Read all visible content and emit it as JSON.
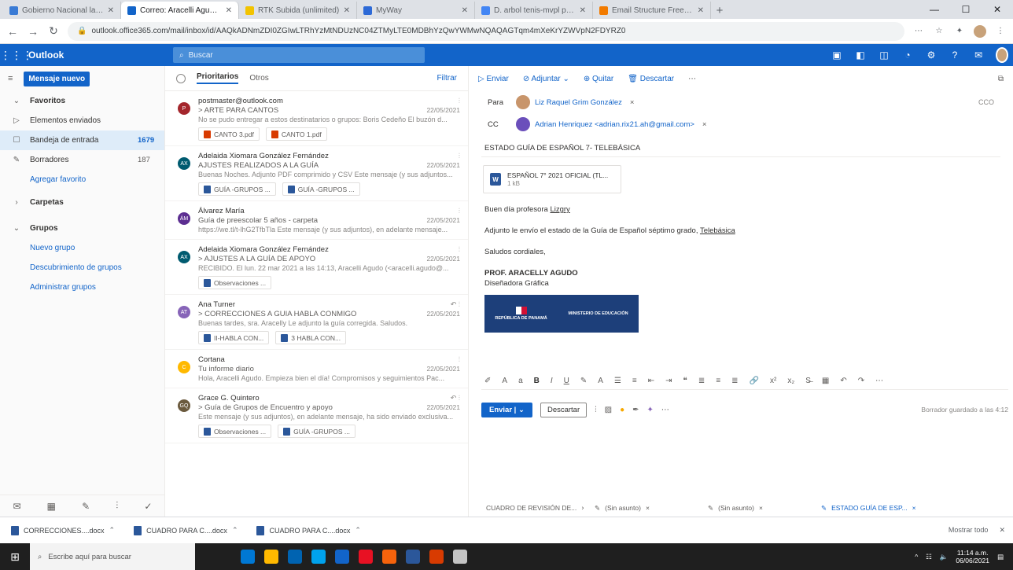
{
  "browser": {
    "tabs": [
      {
        "title": "Gobierno Nacional lanza Plan E...",
        "color": "#3a7bd5"
      },
      {
        "title": "Correo: Aracelli Agudo - Outlook",
        "color": "#1264c9",
        "active": true
      },
      {
        "title": "RTK Subida (unlimited)",
        "color": "#f2c300"
      },
      {
        "title": "MyWay",
        "color": "#2d6ad7"
      },
      {
        "title": "D. arbol tenis-mvpl pell - Buscar",
        "color": "#4285f4"
      },
      {
        "title": "Email Structure Free Vector Art",
        "color": "#f27b00"
      }
    ],
    "new_tab": "+",
    "url": "outlook.office365.com/mail/inbox/id/AAQkADNmZDI0ZGIwLTRhYzMtNDUzNC04ZTMyLTE0MDBhYzQwYWMwNQAQAGTqm4mXeKrYZWVpN2FDYRZ0",
    "window_controls": [
      "—",
      "☐",
      "✕"
    ]
  },
  "outlook": {
    "brand": "Outlook",
    "search_placeholder": "Buscar"
  },
  "leftnav": {
    "new_message": "Mensaje nuevo",
    "favorites": "Favoritos",
    "items": [
      {
        "label": "Elementos enviados",
        "count": "",
        "icon": "▷"
      },
      {
        "label": "Bandeja de entrada",
        "count": "1679",
        "icon": "☐",
        "selected": true
      },
      {
        "label": "Borradores",
        "count": "187",
        "icon": "✎"
      },
      {
        "label": "Agregar favorito",
        "count": "",
        "icon": ""
      }
    ],
    "folders": "Carpetas",
    "groups": "Grupos",
    "group_links": [
      "Nuevo grupo",
      "Descubrimiento de grupos",
      "Administrar grupos"
    ]
  },
  "msglist": {
    "tab_focused": "Prioritarios",
    "tab_other": "Otros",
    "filter": "Filtrar",
    "messages": [
      {
        "sender": "postmaster@outlook.com",
        "subject": "> ARTE PARA CANTOS",
        "date": "22/05/2021",
        "preview": "No se pudo entregar a estos destinatarios o grupos: Boris Cedeño El buzón d...",
        "avatar_color": "#a4262c",
        "initials": "P",
        "attachments": [
          "CANTO 3.pdf",
          "CANTO 1.pdf"
        ]
      },
      {
        "sender": "Adelaida Xiomara González Fernández",
        "subject": "AJUSTES REALIZADOS A LA GUÍA",
        "date": "22/05/2021",
        "preview": "Buenas Noches. Adjunto PDF comprimido y CSV Este mensaje (y sus adjuntos...",
        "avatar_color": "#005b70",
        "initials": "AX",
        "attachments": [
          "GUÍA -GRUPOS ...",
          "GUÍA -GRUPOS ..."
        ]
      },
      {
        "sender": "Álvarez María",
        "subject": "Guía de preescolar 5 años - carpeta",
        "date": "22/05/2021",
        "preview": "https://we.tl/t-lhG2TfbTla Este mensaje (y sus adjuntos), en adelante mensaje...",
        "avatar_color": "#5c2e91",
        "initials": "ÁM",
        "attachments": []
      },
      {
        "sender": "Adelaida Xiomara González Fernández",
        "subject": "> AJUSTES A LA GUÍA DE APOYO",
        "date": "22/05/2021",
        "preview": "RECIBIDO. El lun. 22 mar 2021 a las 14:13, Aracelli Agudo (<aracelli.agudo@...",
        "avatar_color": "#005b70",
        "initials": "AX",
        "attachments": [
          "Observaciones ..."
        ]
      },
      {
        "sender": "Ana Turner",
        "subject": "> CORRECCIONES A GUIA HABLA CONMIGO",
        "date": "22/05/2021",
        "preview": "Buenas tardes, sra. Aracelly Le adjunto la guía corregida. Saludos.",
        "avatar_color": "#8764b8",
        "initials": "AT",
        "attachments": [
          "II-HABLA CON...",
          "3 HABLA CON..."
        ]
      },
      {
        "sender": "Cortana",
        "subject": "Tu informe diario",
        "date": "22/05/2021",
        "preview": "Hola, Aracelli Agudo. Empieza bien el día! Compromisos y seguimientos Pac...",
        "avatar_color": "#ffb900",
        "initials": "C",
        "attachments": []
      },
      {
        "sender": "Grace G. Quintero",
        "subject": "> Guía de Grupos de Encuentro y apoyo",
        "date": "22/05/2021",
        "preview": "Este mensaje (y sus adjuntos), en adelante mensaje, ha sido enviado exclusiva...",
        "avatar_color": "#6b5a3e",
        "initials": "GQ",
        "attachments": [
          "Observaciones ...",
          "GUÍA -GRUPOS ..."
        ]
      }
    ]
  },
  "reading": {
    "toolbar": {
      "send": "Enviar",
      "attach": "Adjuntar",
      "delete": "Quitar",
      "discard": "Descartar"
    },
    "to_label": "Para",
    "to_name": "Liz Raquel Grim González",
    "cc_label": "CC",
    "cc_name": "Adrian Henriquez <adrian.rix21.ah@gmail.com>",
    "cco": "CCO",
    "subject": "ESTADO GUÍA DE ESPAÑOL 7- TELEBÁSICA",
    "attachment_name": "ESPAÑOL 7° 2021 OFICIAL (TL...",
    "attachment_size": "1 kB",
    "greeting_pre": "Buen día profesora ",
    "greeting_name": "Lizgry",
    "line1_pre": "Adjunto le envío el estado de la Guía de Español séptimo grado, ",
    "line1_link": "Telebásica",
    "closing": "Saludos cordiales,",
    "sig_name": "PROF. ARACELLY AGUDO",
    "sig_title": "Diseñadora Gráfica",
    "banner_left": "REPÚBLICA DE PANAMÁ",
    "banner_right": "MINISTERIO DE EDUCACIÓN",
    "send_button": "Enviar",
    "discard_button": "Descartar",
    "draft_status": "Borrador guardado a las 4:12",
    "draft_tabs": [
      "CUADRO DE REVISIÓN DE...",
      "(Sin asunto)",
      "(Sin asunto)",
      "ESTADO GUÍA DE ESP..."
    ]
  },
  "downloads": [
    {
      "name": "CORRECCIONES....docx"
    },
    {
      "name": "CUADRO PARA C....docx"
    },
    {
      "name": "CUADRO PARA C....docx"
    }
  ],
  "downloads_show_all": "Mostrar todo",
  "taskbar": {
    "search_placeholder": "Escribe aquí para buscar",
    "time": "11:14 a.m.",
    "date": "06/06/2021",
    "app_colors": [
      "#0078d4",
      "#ffb900",
      "#0063b1",
      "#00a2ed",
      "#1264c9",
      "#e81123",
      "#f7630c",
      "#2b579a",
      "#d83b01",
      "#c3c3c3"
    ]
  }
}
